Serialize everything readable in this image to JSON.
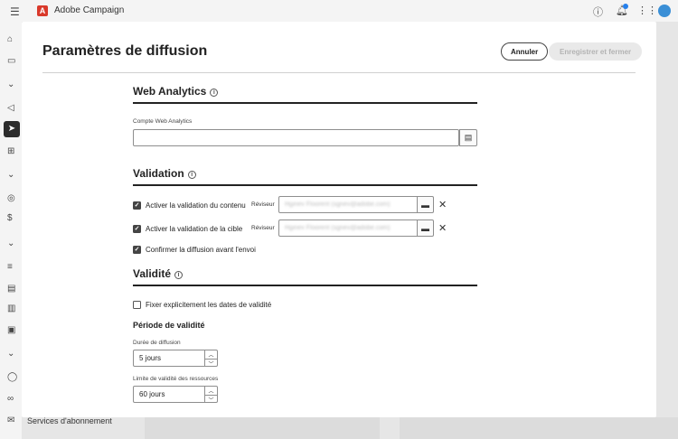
{
  "app": {
    "name": "Adobe Campaign",
    "logo_letter": "A",
    "help_icon": "help-icon",
    "bell_icon": "bell-icon",
    "apps_icon": "apps-grid-icon",
    "accent": "#d9392b"
  },
  "background": {
    "footer_item": "Services d'abonnement"
  },
  "modal": {
    "title": "Paramètres de diffusion",
    "cancel_label": "Annuler",
    "save_label": "Enregistrer et fermer"
  },
  "web_analytics": {
    "title": "Web Analytics",
    "account_label": "Compte Web Analytics",
    "account_value": ""
  },
  "validation": {
    "title": "Validation",
    "content_check_label": "Activer la validation du contenu",
    "content_checked": true,
    "target_check_label": "Activer la validation de la cible",
    "target_checked": true,
    "reviewer_label": "Réviseur",
    "reviewer_content_value": "Hginev Floorent (sgnev@adobe.com)",
    "reviewer_target_value": "Hginev Floorent (sgnev@adobe.com)",
    "confirm_label": "Confirmer la diffusion avant l'envoi",
    "confirm_checked": true
  },
  "validity": {
    "title": "Validité",
    "explicit_dates_label": "Fixer explicitement les dates de validité",
    "explicit_dates_checked": false,
    "period_title": "Période de validité",
    "duration_label": "Durée de diffusion",
    "duration_value": "5 jours",
    "resource_limit_label": "Limite de validité des ressources",
    "resource_limit_value": "60 jours"
  }
}
